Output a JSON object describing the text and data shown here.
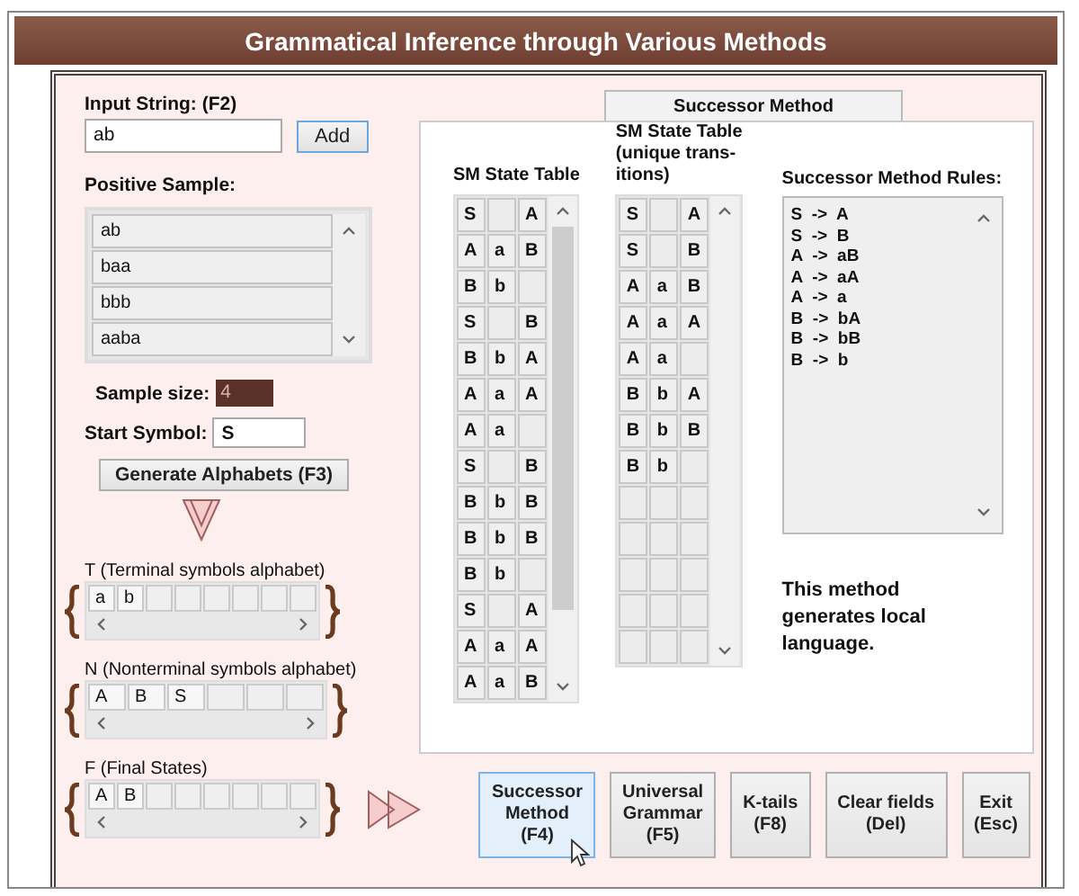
{
  "window": {
    "title": "Grammatical Inference through Various Methods"
  },
  "input_string": {
    "label": "Input String: (F2)",
    "value": "ab",
    "add_button": "Add"
  },
  "positive_sample": {
    "label": "Positive Sample:",
    "items": [
      "ab",
      "baa",
      "bbb",
      "aaba"
    ]
  },
  "sample_size": {
    "label": "Sample size:",
    "value": "4"
  },
  "start_symbol": {
    "label": "Start Symbol:",
    "value": "S"
  },
  "generate_button": "Generate Alphabets (F3)",
  "alphabets": [
    {
      "label": "T (Terminal symbols alphabet)",
      "symbols": [
        "a",
        "b"
      ]
    },
    {
      "label": "N (Nonterminal symbols alphabet)",
      "symbols": [
        "A",
        "B",
        "S"
      ]
    },
    {
      "label": "F (Final States)",
      "symbols": [
        "A",
        "B"
      ]
    }
  ],
  "tabs": [
    {
      "label": "Successor Method",
      "selected": true
    }
  ],
  "state_table": {
    "title_lines": [
      "SM State Table"
    ],
    "rows": [
      {
        "from": "S",
        "to": "A"
      },
      {
        "from": "A",
        "symbol": "a",
        "to": "B"
      },
      {
        "from": "B",
        "symbol": "b"
      },
      {
        "from": "S",
        "to": "B"
      },
      {
        "from": "B",
        "symbol": "b",
        "to": "A"
      },
      {
        "from": "A",
        "symbol": "a",
        "to": "A"
      },
      {
        "from": "A",
        "symbol": "a"
      },
      {
        "from": "S",
        "to": "B"
      },
      {
        "from": "B",
        "symbol": "b",
        "to": "B"
      },
      {
        "from": "B",
        "symbol": "b",
        "to": "B"
      },
      {
        "from": "B",
        "symbol": "b"
      },
      {
        "from": "S",
        "to": "A"
      },
      {
        "from": "A",
        "symbol": "a",
        "to": "A"
      },
      {
        "from": "A",
        "symbol": "a",
        "to": "B"
      }
    ]
  },
  "unique_table": {
    "title_lines": [
      "SM State Table",
      "(unique trans-",
      "itions)"
    ],
    "rows": [
      {
        "from": "S",
        "to": "A"
      },
      {
        "from": "S",
        "to": "B"
      },
      {
        "from": "A",
        "symbol": "a",
        "to": "B"
      },
      {
        "from": "A",
        "symbol": "a",
        "to": "A"
      },
      {
        "from": "A",
        "symbol": "a"
      },
      {
        "from": "B",
        "symbol": "b",
        "to": "A"
      },
      {
        "from": "B",
        "symbol": "b",
        "to": "B"
      },
      {
        "from": "B",
        "symbol": "b"
      }
    ]
  },
  "rules": {
    "label": "Successor Method Rules:",
    "items": [
      "S  ->  A",
      "S  ->  B",
      "A  ->  aB",
      "A  ->  aA",
      "A  ->  a",
      "B  ->  bA",
      "B  ->  bB",
      "B  ->  b"
    ]
  },
  "note": "This method generates local language.",
  "buttons": [
    {
      "lines": [
        "Successor",
        "Method",
        "(F4)"
      ],
      "selected": true
    },
    {
      "lines": [
        "Universal",
        "Grammar",
        "(F5)"
      ],
      "selected": false
    },
    {
      "lines": [
        "K-tails",
        "(F8)"
      ],
      "selected": false
    },
    {
      "lines": [
        "Clear fields",
        "(Del)"
      ],
      "selected": false
    },
    {
      "lines": [
        "Exit",
        "(Esc)"
      ],
      "selected": false
    }
  ]
}
